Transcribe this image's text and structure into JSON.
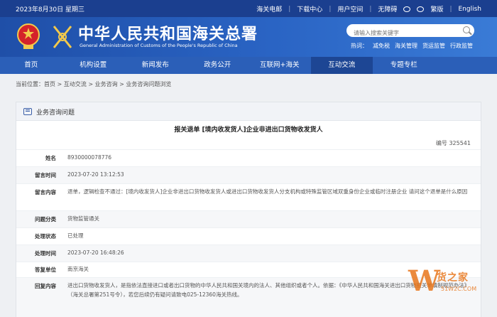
{
  "topbar": {
    "date": "2023年8月30日 星期三",
    "links": [
      "海关电邮",
      "下载中心",
      "用户空间",
      "无障碍",
      "繁版",
      "English"
    ]
  },
  "header": {
    "title": "中华人民共和国海关总署",
    "subtitle": "General Administration of Customs of the People's Republic of China",
    "search_placeholder": "请输入搜索关键字",
    "hot_label": "热词：",
    "hot_words": [
      "减免税",
      "海关管理",
      "货运监管",
      "行政监管"
    ]
  },
  "nav": [
    {
      "label": "首页",
      "active": false
    },
    {
      "label": "机构设置",
      "active": false
    },
    {
      "label": "新闻发布",
      "active": false
    },
    {
      "label": "政务公开",
      "active": false
    },
    {
      "label": "互联网+海关",
      "active": false
    },
    {
      "label": "互动交流",
      "active": true
    },
    {
      "label": "专题专栏",
      "active": false
    }
  ],
  "breadcrumb": "当前位置：首页 > 互动交流 > 业务咨询 > 业务咨询问题浏览",
  "panel": {
    "title": "业务咨询问题",
    "question_title": "报关退单 [境内收发货人]企业非进出口货物收发货人",
    "number": "编号  325541",
    "rows": [
      {
        "label": "姓名",
        "value": "8930000078776"
      },
      {
        "label": "留言时间",
        "value": "2023-07-20 13:12:53"
      },
      {
        "label": "留言内容",
        "value": "退单，逻辑检查不通过：[境内收发货人]企业非进出口货物收发货人或进出口货物收发货人分支机构或特殊监管区域双重身份企业或临时注册企业 请问这个退单是什么原因"
      },
      {
        "label": "问题分类",
        "value": "货物监管通关"
      },
      {
        "label": "处理状态",
        "value": "已处理"
      },
      {
        "label": "处理时间",
        "value": "2023-07-20 16:48:26"
      },
      {
        "label": "答复单位",
        "value": "南京海关"
      },
      {
        "label": "回复内容",
        "value": "进出口货物收发货人，是指依法直接进口或者出口货物的中华人民共和国关境内的法人、其他组织或者个人。依据：《中华人民共和国海关进出口货物报关单填制规范办法》（海关总署第251号令），若您后续仍有疑问请致电025-12360海关热线。"
      }
    ]
  },
  "watermark": {
    "letter": "W",
    "text": "货之家",
    "domain": "51W2C.COM"
  },
  "colors": {
    "topbar": "#1b3f8f",
    "nav": "#2b5fb8",
    "nav_active": "#1d4694",
    "watermark": "#e8761c"
  }
}
